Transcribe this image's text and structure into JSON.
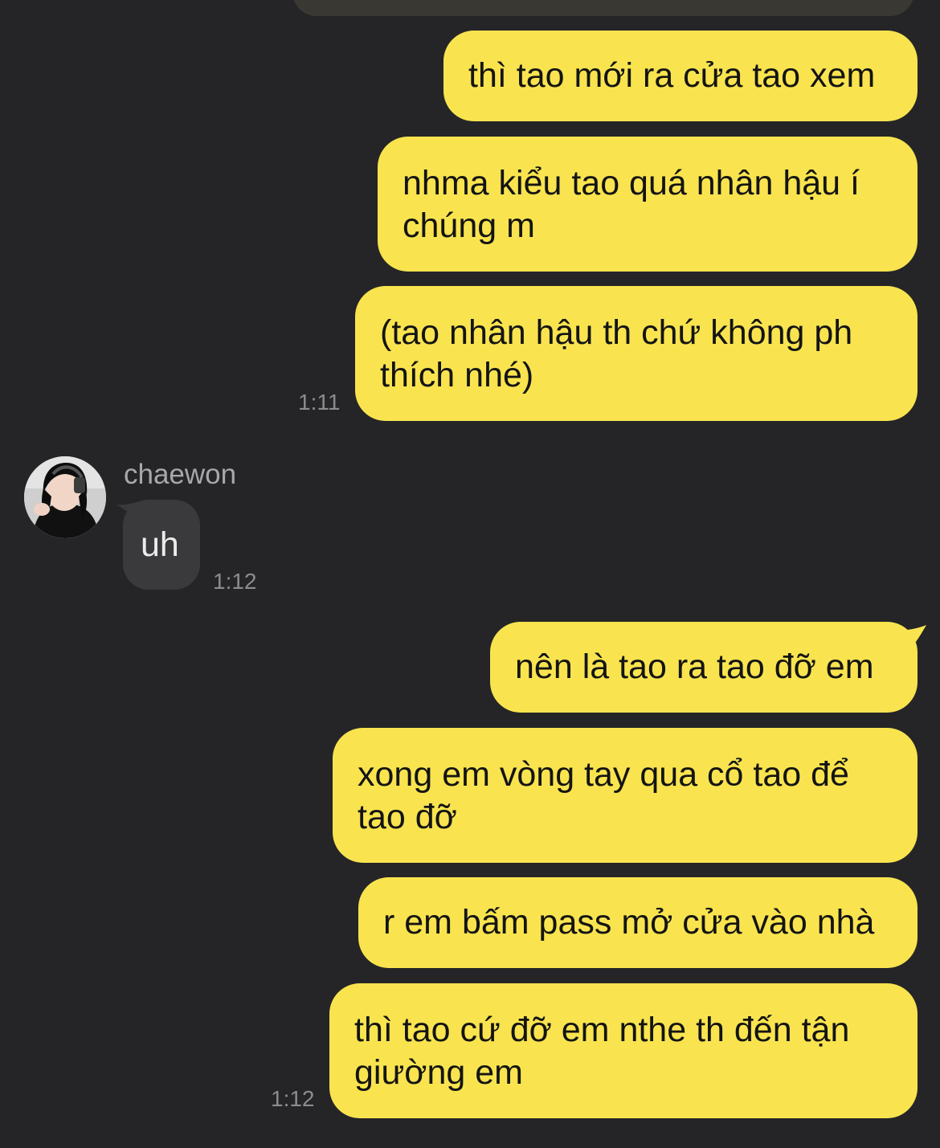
{
  "contact": {
    "name": "chaewon"
  },
  "messages": [
    {
      "from": "me",
      "text": "thì tao mới ra cửa tao xem"
    },
    {
      "from": "me",
      "text": "nhma kiểu tao quá nhân hậu í\nchúng m"
    },
    {
      "from": "me",
      "text": "(tao nhân hậu th chứ không ph\nthích nhé)",
      "time": "1:11"
    },
    {
      "from": "chaewon",
      "text": "uh",
      "time": "1:12"
    },
    {
      "from": "me",
      "text": "nên là tao ra tao đỡ em"
    },
    {
      "from": "me",
      "text": "xong em vòng tay qua cổ tao để\ntao đỡ"
    },
    {
      "from": "me",
      "text": "r em bấm pass mở cửa vào nhà"
    },
    {
      "from": "me",
      "text": "thì tao cứ đỡ em nthe th đến tận\ngiường em",
      "time": "1:12"
    }
  ],
  "colors": {
    "background": "#252527",
    "outgoing_bubble": "#f9e44f",
    "incoming_bubble": "#3a3a3c",
    "timestamp": "#8c8c8e"
  }
}
